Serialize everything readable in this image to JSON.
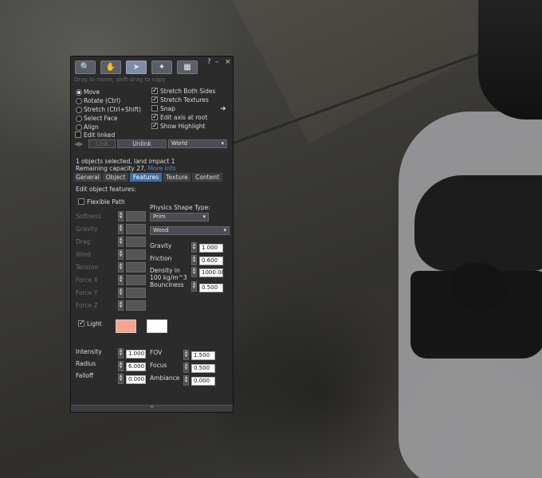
{
  "toolbar": {
    "tools": [
      {
        "name": "focus-tool",
        "icon": "magnifier-icon"
      },
      {
        "name": "move-tool",
        "icon": "hand-icon"
      },
      {
        "name": "edit-tool",
        "icon": "pointer-icon"
      },
      {
        "name": "create-tool",
        "icon": "wand-icon"
      },
      {
        "name": "land-tool",
        "icon": "bulldozer-icon"
      }
    ],
    "help": "?",
    "minimize": "–",
    "close": "×",
    "hint": "Drag to move, shift-drag to copy"
  },
  "modes": {
    "move": "Move",
    "rotate": "Rotate (Ctrl)",
    "stretch": "Stretch (Ctrl+Shift)",
    "select_face": "Select Face",
    "align": "Align",
    "edit_linked": "Edit linked",
    "selected_mode": "Move"
  },
  "options": {
    "stretch_both_sides": "Stretch Both Sides",
    "stretch_textures": "Stretch Textures",
    "snap": "Snap",
    "edit_axis_at_root": "Edit axis at root",
    "show_highlight": "Show Highlight"
  },
  "link_bar": {
    "link": "Link",
    "unlink": "Unlink",
    "grid": "World"
  },
  "status": {
    "selection": "1 objects selected, land impact 1",
    "capacity": "Remaining capacity 27.",
    "more_info": "More info"
  },
  "tabs": [
    "General",
    "Object",
    "Features",
    "Texture",
    "Content"
  ],
  "active_tab": "Features",
  "features": {
    "heading": "Edit object features:",
    "flexible_path": "Flexible Path",
    "flex_params": [
      "Softness",
      "Gravity",
      "Drag",
      "Wind",
      "Tension",
      "Force X",
      "Force Y",
      "Force Z"
    ],
    "physics_shape_label": "Physics Shape Type:",
    "physics_shape": "Prim",
    "material": "Wood",
    "physics": [
      {
        "label": "Gravity",
        "value": "1.000"
      },
      {
        "label": "Friction",
        "value": "0.600"
      },
      {
        "label": "Density in 100 kg/m^3",
        "value": "1000.00"
      },
      {
        "label": "Bounciness",
        "value": "0.500"
      }
    ],
    "light_label": "Light",
    "light_color": "#f5a58c",
    "light_texture_color": "#ffffff",
    "light_params_left": [
      {
        "label": "Intensity",
        "value": "1.000"
      },
      {
        "label": "Radius",
        "value": "6.000"
      },
      {
        "label": "Falloff",
        "value": "0.000"
      }
    ],
    "light_params_right": [
      {
        "label": "FOV",
        "value": "1.500"
      },
      {
        "label": "Focus",
        "value": "0.500"
      },
      {
        "label": "Ambiance",
        "value": "0.000"
      }
    ]
  },
  "scroll_indicator": "^"
}
